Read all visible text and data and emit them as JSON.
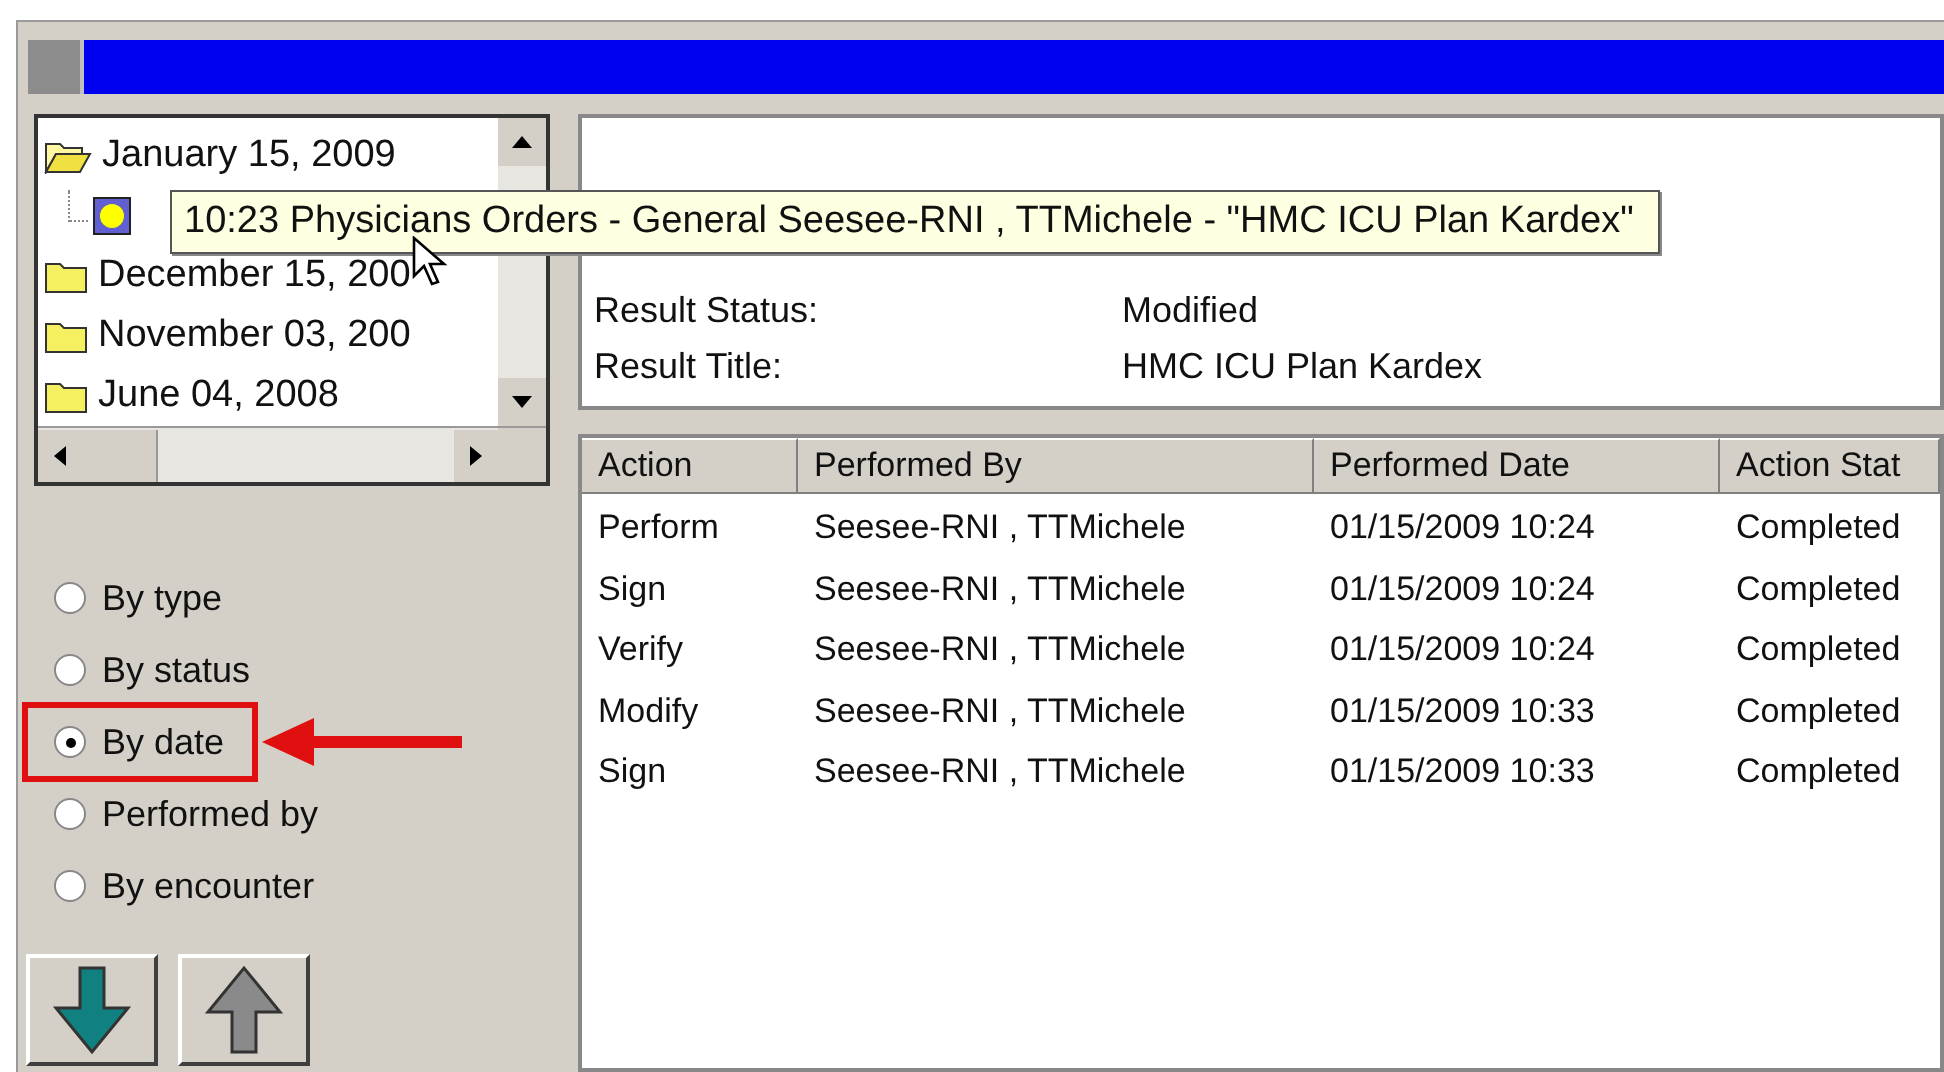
{
  "tree": [
    {
      "label": "January 15, 2009",
      "expanded": true,
      "children": [
        {
          "kind": "document"
        }
      ]
    },
    {
      "label": "December 15, 200",
      "expanded": false
    },
    {
      "label": "November 03, 200",
      "expanded": false
    },
    {
      "label": "June 04, 2008",
      "expanded": false
    }
  ],
  "tooltip": "10:23  Physicians Orders - General Seesee-RNI , TTMichele  - \"HMC ICU Plan Kardex\"",
  "details": [
    {
      "label": "Result Status:",
      "value": "Modified"
    },
    {
      "label": "Result Title:",
      "value": "HMC ICU Plan Kardex"
    }
  ],
  "sort_options": [
    {
      "label": "By type",
      "selected": false,
      "annotated": false
    },
    {
      "label": "By status",
      "selected": false,
      "annotated": false
    },
    {
      "label": "By date",
      "selected": true,
      "annotated": true
    },
    {
      "label": "Performed by",
      "selected": false,
      "annotated": false
    },
    {
      "label": "By encounter",
      "selected": false,
      "annotated": false
    }
  ],
  "nav_buttons": [
    {
      "kind": "down",
      "disabled": false
    },
    {
      "kind": "up",
      "disabled": true
    }
  ],
  "table": {
    "columns": [
      "Action",
      "Performed By",
      "Performed Date",
      "Action Stat"
    ],
    "rows": [
      [
        "Perform",
        "Seesee-RNI , TTMichele",
        "01/15/2009 10:24",
        "Completed"
      ],
      [
        "Sign",
        "Seesee-RNI , TTMichele",
        "01/15/2009 10:24",
        "Completed"
      ],
      [
        "Verify",
        "Seesee-RNI , TTMichele",
        "01/15/2009 10:24",
        "Completed"
      ],
      [
        "Modify",
        "Seesee-RNI , TTMichele",
        "01/15/2009 10:33",
        "Completed"
      ],
      [
        "Sign",
        "Seesee-RNI , TTMichele",
        "01/15/2009 10:33",
        "Completed"
      ]
    ]
  }
}
